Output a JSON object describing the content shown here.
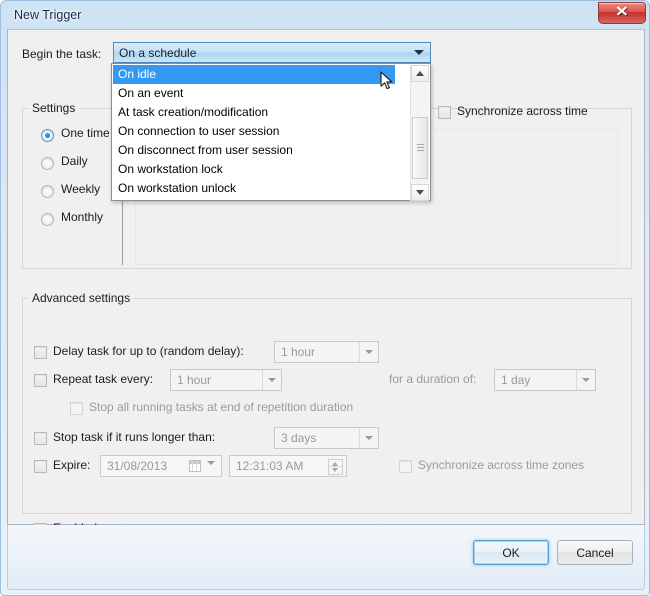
{
  "window": {
    "title": "New Trigger",
    "close_label": "✕"
  },
  "begin": {
    "label": "Begin the task:",
    "selected": "On a schedule",
    "options": [
      "On idle",
      "On an event",
      "At task creation/modification",
      "On connection to user session",
      "On disconnect from user session",
      "On workstation lock",
      "On workstation unlock"
    ],
    "highlighted_index": 0
  },
  "settings": {
    "title": "Settings",
    "radios": [
      {
        "label": "One time",
        "checked": true
      },
      {
        "label": "Daily",
        "checked": false
      },
      {
        "label": "Weekly",
        "checked": false
      },
      {
        "label": "Monthly",
        "checked": false
      }
    ],
    "sync_across_time": {
      "label": "Synchronize across time",
      "checked": false
    }
  },
  "advanced": {
    "title": "Advanced settings",
    "delay_task": {
      "label": "Delay task for up to (random delay):",
      "checked": false,
      "value": "1 hour"
    },
    "repeat_task": {
      "label": "Repeat task every:",
      "checked": false,
      "value": "1 hour",
      "duration_label": "for a duration of:",
      "duration_value": "1 day"
    },
    "stop_all_running": {
      "label": "Stop all running tasks at end of repetition duration",
      "checked": false
    },
    "stop_task": {
      "label": "Stop task if it runs longer than:",
      "checked": false,
      "value": "3 days"
    },
    "expire": {
      "label": "Expire:",
      "checked": false,
      "date": "31/08/2013",
      "time": "12:31:03 AM",
      "sync_label": "Synchronize across time zones",
      "sync_checked": false
    },
    "enabled": {
      "label": "Enabled",
      "checked": true
    }
  },
  "footer": {
    "ok_label": "OK",
    "cancel_label": "Cancel"
  }
}
